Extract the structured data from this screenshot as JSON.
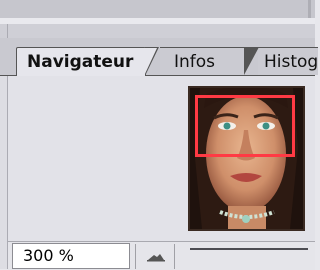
{
  "tabs": [
    {
      "label": "Navigateur",
      "active": true
    },
    {
      "label": "Infos",
      "active": false
    },
    {
      "label": "Histog",
      "active": false
    }
  ],
  "zoom": {
    "value": "300 %"
  },
  "icons": {
    "zoom_out": "mountain-small-icon",
    "preview": "navigator-thumbnail"
  },
  "colors": {
    "view_box": "#ff3a44",
    "panel": "#e2e2e8",
    "tab_bar": "#c9c9d0"
  }
}
